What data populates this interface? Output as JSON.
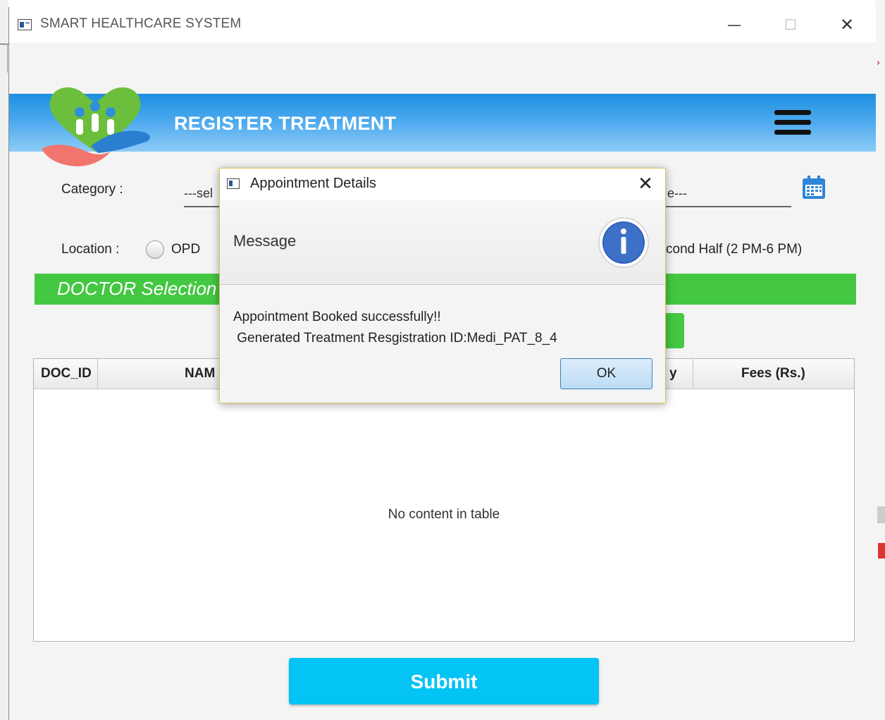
{
  "window": {
    "title": "SMART HEALTHCARE SYSTEM",
    "min": "—",
    "max": "☐",
    "close": "✕"
  },
  "header": {
    "title": "REGISTER TREATMENT"
  },
  "form": {
    "category_label": "Category :",
    "category_value": "---sel",
    "right_combo_value": "e---",
    "location_label": "Location :",
    "location_option": "OPD",
    "slot_option": "cond Half (2 PM-6 PM)"
  },
  "section": {
    "title": "DOCTOR Selection"
  },
  "table": {
    "columns": [
      "DOC_ID",
      "NAM",
      "y",
      "Fees (Rs.)"
    ],
    "empty_text": "No content in table"
  },
  "submit_label": "Submit",
  "dialog": {
    "title": "Appointment Details",
    "close": "✕",
    "header": "Message",
    "line1": "Appointment Booked successfully!!",
    "line2": " Generated Treatment Resgistration ID:Medi_PAT_8_4",
    "ok": "OK"
  },
  "colors": {
    "banner": "#1d8fe0",
    "section": "#44c742",
    "submit": "#04c3f5",
    "info": "#2e5fb8"
  }
}
